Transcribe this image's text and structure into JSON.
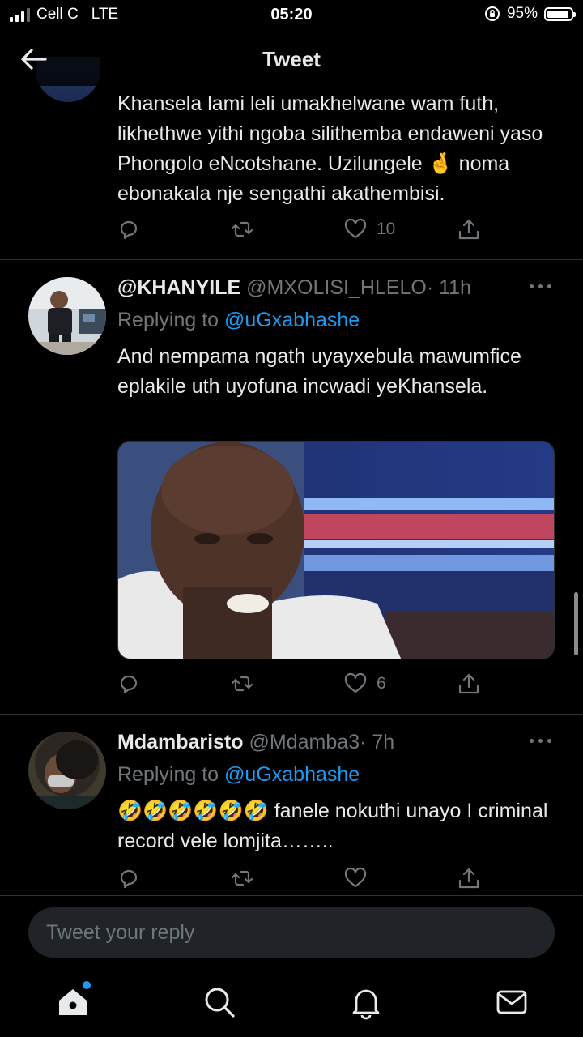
{
  "status_bar": {
    "carrier": "Cell C",
    "network": "LTE",
    "time": "05:20",
    "battery": "95%",
    "battery_level": 0.95
  },
  "header": {
    "title": "Tweet",
    "back_icon": "arrow-left-icon"
  },
  "tweets": [
    {
      "text": "Khansela lami leli umakhelwane wam futh, likhethwe yithi ngoba silithemba endaweni yaso Phongolo eNcotshane. Uzilungele 🤞 noma ebonakala nje sengathi akathembisi.",
      "likes": "10"
    },
    {
      "name": "@KHANYILE",
      "handle": "@MXOLISI_HLELO",
      "time": "· 11h",
      "replying_prefix": "Replying to",
      "replying_to": "@uGxabhashe",
      "text": "And nempama ngath uyayxebula mawumfice eplakile uth uyofuna incwadi yeKhansela.",
      "likes": "6"
    },
    {
      "name": "Mdambaristo",
      "handle": "@Mdamba3",
      "time": "· 7h",
      "replying_prefix": "Replying to",
      "replying_to": "@uGxabhashe",
      "text": "🤣🤣🤣🤣🤣🤣 fanele nokuthi unayo I criminal record vele lomjita……..",
      "likes": ""
    }
  ],
  "reply": {
    "placeholder": "Tweet your reply"
  },
  "colors": {
    "background": "#000000",
    "accent": "#1d9bf0",
    "muted": "#71767b",
    "text": "#e7e9ea"
  },
  "icons": [
    "reply-icon",
    "retweet-icon",
    "like-icon",
    "share-icon",
    "more-icon",
    "home-icon",
    "search-icon",
    "notifications-icon",
    "messages-icon"
  ]
}
